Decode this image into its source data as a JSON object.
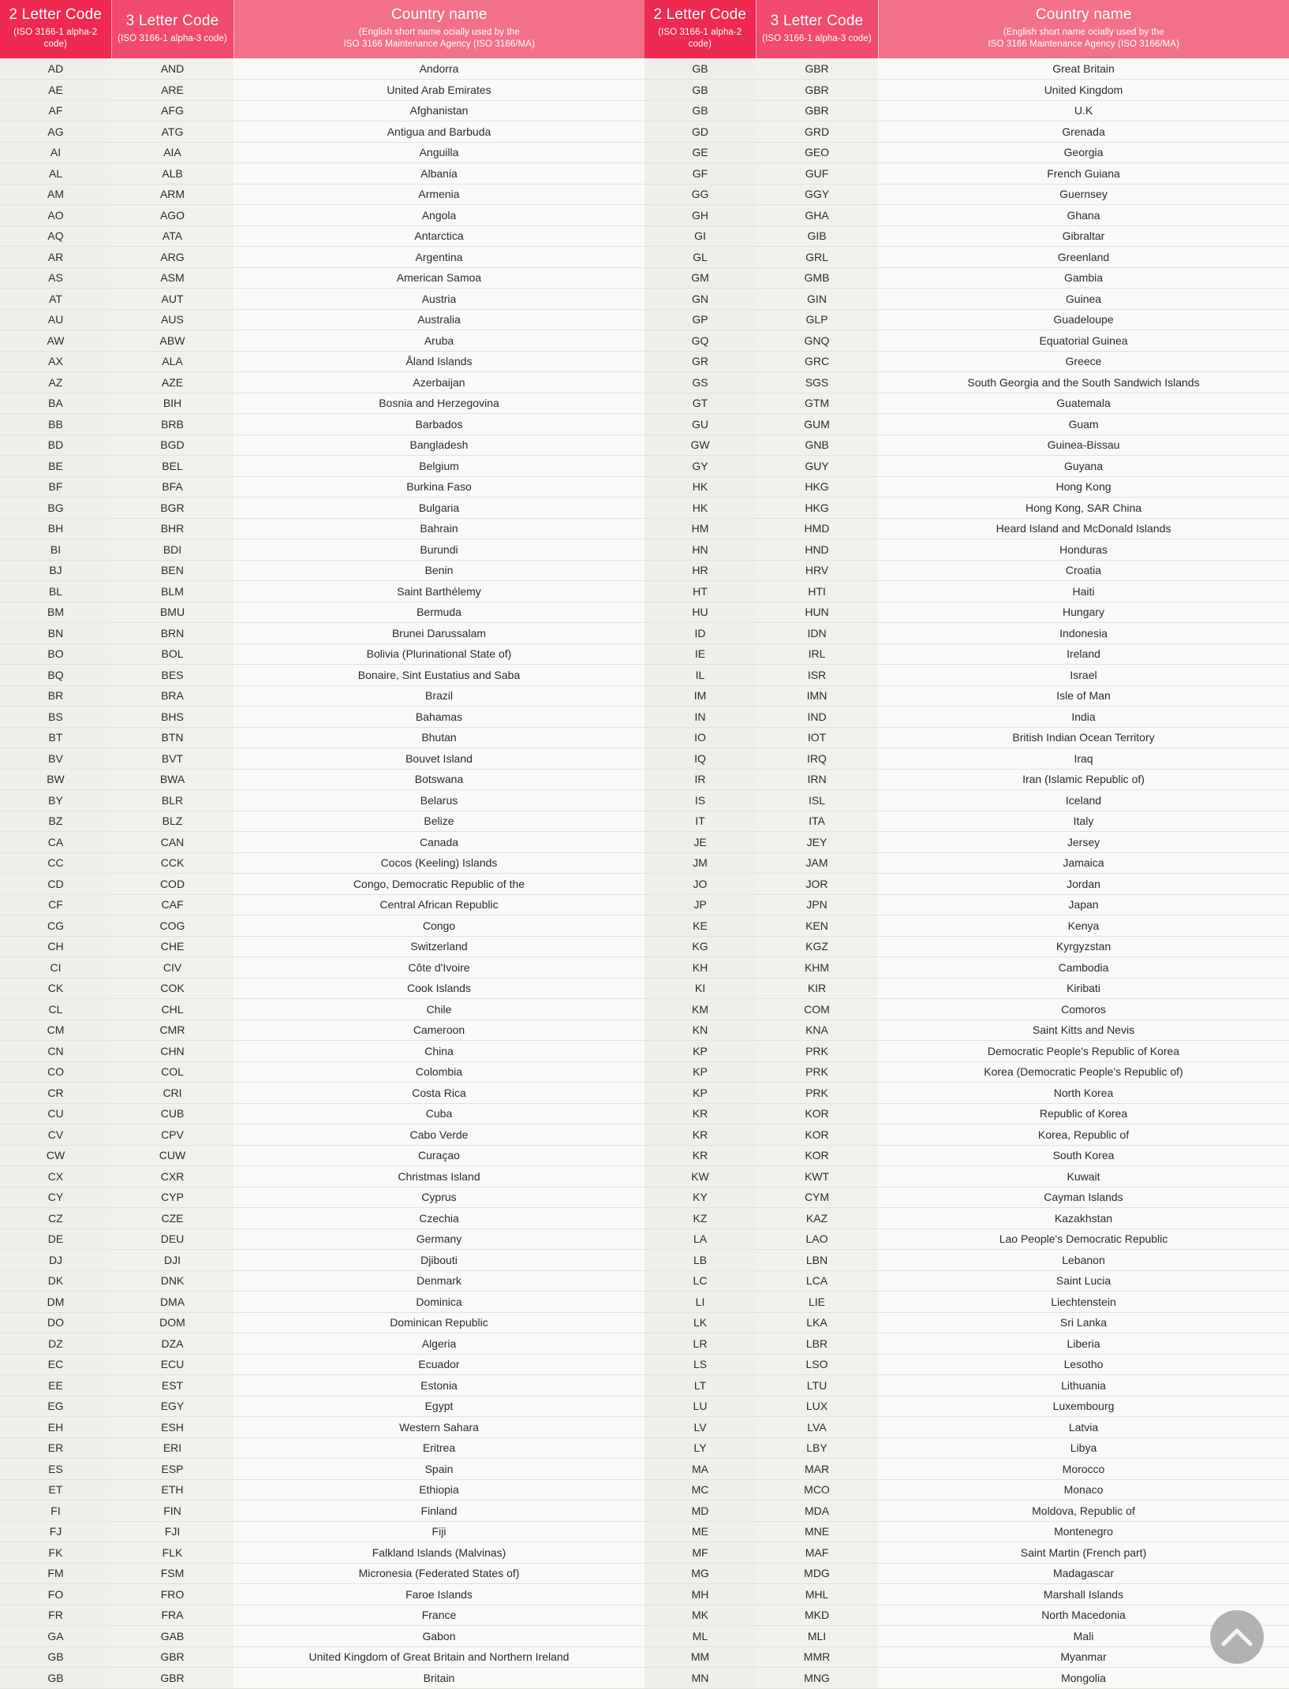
{
  "header": {
    "col_2letter_title": "2 Letter Code",
    "col_2letter_sub": "(ISO 3166-1 alpha-2 code)",
    "col_3letter_title": "3 Letter Code",
    "col_3letter_sub": "(ISO 3166-1 alpha-3 code)",
    "col_country_title": "Country name",
    "col_country_sub1": "(English short name ocially used by the",
    "col_country_sub2": "ISO 3166 Maintenance Agency (ISO 3166/MA)"
  },
  "colors": {
    "header_2letter": "#ef2a52",
    "header_3letter": "#f04a6d",
    "header_country": "#f27189",
    "row_2letter": "#efeeeb",
    "row_3letter": "#f1f0ed",
    "row_country": "#faf9f8",
    "row_border": "#e3e1de",
    "scroll_button": "#b4b2b0"
  },
  "controls": {
    "scroll_top_label": "scroll to top"
  },
  "left_table": [
    [
      "AD",
      "AND",
      "Andorra"
    ],
    [
      "AE",
      "ARE",
      "United Arab Emirates"
    ],
    [
      "AF",
      "AFG",
      "Afghanistan"
    ],
    [
      "AG",
      "ATG",
      "Antigua and Barbuda"
    ],
    [
      "AI",
      "AIA",
      "Anguilla"
    ],
    [
      "AL",
      "ALB",
      "Albania"
    ],
    [
      "AM",
      "ARM",
      "Armenia"
    ],
    [
      "AO",
      "AGO",
      "Angola"
    ],
    [
      "AQ",
      "ATA",
      "Antarctica"
    ],
    [
      "AR",
      "ARG",
      "Argentina"
    ],
    [
      "AS",
      "ASM",
      "American Samoa"
    ],
    [
      "AT",
      "AUT",
      "Austria"
    ],
    [
      "AU",
      "AUS",
      "Australia"
    ],
    [
      "AW",
      "ABW",
      "Aruba"
    ],
    [
      "AX",
      "ALA",
      "Åland Islands"
    ],
    [
      "AZ",
      "AZE",
      "Azerbaijan"
    ],
    [
      "BA",
      "BIH",
      "Bosnia and Herzegovina"
    ],
    [
      "BB",
      "BRB",
      "Barbados"
    ],
    [
      "BD",
      "BGD",
      "Bangladesh"
    ],
    [
      "BE",
      "BEL",
      "Belgium"
    ],
    [
      "BF",
      "BFA",
      "Burkina Faso"
    ],
    [
      "BG",
      "BGR",
      "Bulgaria"
    ],
    [
      "BH",
      "BHR",
      "Bahrain"
    ],
    [
      "BI",
      "BDI",
      "Burundi"
    ],
    [
      "BJ",
      "BEN",
      "Benin"
    ],
    [
      "BL",
      "BLM",
      "Saint Barthélemy"
    ],
    [
      "BM",
      "BMU",
      "Bermuda"
    ],
    [
      "BN",
      "BRN",
      "Brunei Darussalam"
    ],
    [
      "BO",
      "BOL",
      "Bolivia (Plurinational State of)"
    ],
    [
      "BQ",
      "BES",
      "Bonaire, Sint Eustatius and Saba"
    ],
    [
      "BR",
      "BRA",
      "Brazil"
    ],
    [
      "BS",
      "BHS",
      "Bahamas"
    ],
    [
      "BT",
      "BTN",
      "Bhutan"
    ],
    [
      "BV",
      "BVT",
      "Bouvet Island"
    ],
    [
      "BW",
      "BWA",
      "Botswana"
    ],
    [
      "BY",
      "BLR",
      "Belarus"
    ],
    [
      "BZ",
      "BLZ",
      "Belize"
    ],
    [
      "CA",
      "CAN",
      "Canada"
    ],
    [
      "CC",
      "CCK",
      "Cocos (Keeling) Islands"
    ],
    [
      "CD",
      "COD",
      "Congo, Democratic Republic of the"
    ],
    [
      "CF",
      "CAF",
      "Central African Republic"
    ],
    [
      "CG",
      "COG",
      "Congo"
    ],
    [
      "CH",
      "CHE",
      "Switzerland"
    ],
    [
      "CI",
      "CIV",
      "Côte d'Ivoire"
    ],
    [
      "CK",
      "COK",
      "Cook Islands"
    ],
    [
      "CL",
      "CHL",
      "Chile"
    ],
    [
      "CM",
      "CMR",
      "Cameroon"
    ],
    [
      "CN",
      "CHN",
      "China"
    ],
    [
      "CO",
      "COL",
      "Colombia"
    ],
    [
      "CR",
      "CRI",
      "Costa Rica"
    ],
    [
      "CU",
      "CUB",
      "Cuba"
    ],
    [
      "CV",
      "CPV",
      "Cabo Verde"
    ],
    [
      "CW",
      "CUW",
      "Curaçao"
    ],
    [
      "CX",
      "CXR",
      "Christmas Island"
    ],
    [
      "CY",
      "CYP",
      "Cyprus"
    ],
    [
      "CZ",
      "CZE",
      "Czechia"
    ],
    [
      "DE",
      "DEU",
      "Germany"
    ],
    [
      "DJ",
      "DJI",
      "Djibouti"
    ],
    [
      "DK",
      "DNK",
      "Denmark"
    ],
    [
      "DM",
      "DMA",
      "Dominica"
    ],
    [
      "DO",
      "DOM",
      "Dominican Republic"
    ],
    [
      "DZ",
      "DZA",
      "Algeria"
    ],
    [
      "EC",
      "ECU",
      "Ecuador"
    ],
    [
      "EE",
      "EST",
      "Estonia"
    ],
    [
      "EG",
      "EGY",
      "Egypt"
    ],
    [
      "EH",
      "ESH",
      "Western Sahara"
    ],
    [
      "ER",
      "ERI",
      "Eritrea"
    ],
    [
      "ES",
      "ESP",
      "Spain"
    ],
    [
      "ET",
      "ETH",
      "Ethiopia"
    ],
    [
      "FI",
      "FIN",
      "Finland"
    ],
    [
      "FJ",
      "FJI",
      "Fiji"
    ],
    [
      "FK",
      "FLK",
      "Falkland Islands (Malvinas)"
    ],
    [
      "FM",
      "FSM",
      "Micronesia (Federated States of)"
    ],
    [
      "FO",
      "FRO",
      "Faroe Islands"
    ],
    [
      "FR",
      "FRA",
      "France"
    ],
    [
      "GA",
      "GAB",
      "Gabon"
    ],
    [
      "GB",
      "GBR",
      "United Kingdom of Great Britain and Northern Ireland"
    ],
    [
      "GB",
      "GBR",
      "Britain"
    ]
  ],
  "right_table": [
    [
      "GB",
      "GBR",
      "Great Britain"
    ],
    [
      "GB",
      "GBR",
      "United Kingdom"
    ],
    [
      "GB",
      "GBR",
      "U.K"
    ],
    [
      "GD",
      "GRD",
      "Grenada"
    ],
    [
      "GE",
      "GEO",
      "Georgia"
    ],
    [
      "GF",
      "GUF",
      "French Guiana"
    ],
    [
      "GG",
      "GGY",
      "Guernsey"
    ],
    [
      "GH",
      "GHA",
      "Ghana"
    ],
    [
      "GI",
      "GIB",
      "Gibraltar"
    ],
    [
      "GL",
      "GRL",
      "Greenland"
    ],
    [
      "GM",
      "GMB",
      "Gambia"
    ],
    [
      "GN",
      "GIN",
      "Guinea"
    ],
    [
      "GP",
      "GLP",
      "Guadeloupe"
    ],
    [
      "GQ",
      "GNQ",
      "Equatorial Guinea"
    ],
    [
      "GR",
      "GRC",
      "Greece"
    ],
    [
      "GS",
      "SGS",
      "South Georgia and the South Sandwich Islands"
    ],
    [
      "GT",
      "GTM",
      "Guatemala"
    ],
    [
      "GU",
      "GUM",
      "Guam"
    ],
    [
      "GW",
      "GNB",
      "Guinea-Bissau"
    ],
    [
      "GY",
      "GUY",
      "Guyana"
    ],
    [
      "HK",
      "HKG",
      "Hong Kong"
    ],
    [
      "HK",
      "HKG",
      "Hong Kong, SAR China"
    ],
    [
      "HM",
      "HMD",
      "Heard Island and McDonald Islands"
    ],
    [
      "HN",
      "HND",
      "Honduras"
    ],
    [
      "HR",
      "HRV",
      "Croatia"
    ],
    [
      "HT",
      "HTI",
      "Haiti"
    ],
    [
      "HU",
      "HUN",
      "Hungary"
    ],
    [
      "ID",
      "IDN",
      "Indonesia"
    ],
    [
      "IE",
      "IRL",
      "Ireland"
    ],
    [
      "IL",
      "ISR",
      "Israel"
    ],
    [
      "IM",
      "IMN",
      "Isle of Man"
    ],
    [
      "IN",
      "IND",
      "India"
    ],
    [
      "IO",
      "IOT",
      "British Indian Ocean Territory"
    ],
    [
      "IQ",
      "IRQ",
      "Iraq"
    ],
    [
      "IR",
      "IRN",
      "Iran (Islamic Republic of)"
    ],
    [
      "IS",
      "ISL",
      "Iceland"
    ],
    [
      "IT",
      "ITA",
      "Italy"
    ],
    [
      "JE",
      "JEY",
      "Jersey"
    ],
    [
      "JM",
      "JAM",
      "Jamaica"
    ],
    [
      "JO",
      "JOR",
      "Jordan"
    ],
    [
      "JP",
      "JPN",
      "Japan"
    ],
    [
      "KE",
      "KEN",
      "Kenya"
    ],
    [
      "KG",
      "KGZ",
      "Kyrgyzstan"
    ],
    [
      "KH",
      "KHM",
      "Cambodia"
    ],
    [
      "KI",
      "KIR",
      "Kiribati"
    ],
    [
      "KM",
      "COM",
      "Comoros"
    ],
    [
      "KN",
      "KNA",
      "Saint Kitts and Nevis"
    ],
    [
      "KP",
      "PRK",
      "Democratic People's Republic of Korea"
    ],
    [
      "KP",
      "PRK",
      "Korea (Democratic People's Republic of)"
    ],
    [
      "KP",
      "PRK",
      "North Korea"
    ],
    [
      "KR",
      "KOR",
      "Republic of Korea"
    ],
    [
      "KR",
      "KOR",
      "Korea, Republic of"
    ],
    [
      "KR",
      "KOR",
      "South Korea"
    ],
    [
      "KW",
      "KWT",
      "Kuwait"
    ],
    [
      "KY",
      "CYM",
      "Cayman Islands"
    ],
    [
      "KZ",
      "KAZ",
      "Kazakhstan"
    ],
    [
      "LA",
      "LAO",
      "Lao People's Democratic Republic"
    ],
    [
      "LB",
      "LBN",
      "Lebanon"
    ],
    [
      "LC",
      "LCA",
      "Saint Lucia"
    ],
    [
      "LI",
      "LIE",
      "Liechtenstein"
    ],
    [
      "LK",
      "LKA",
      "Sri Lanka"
    ],
    [
      "LR",
      "LBR",
      "Liberia"
    ],
    [
      "LS",
      "LSO",
      "Lesotho"
    ],
    [
      "LT",
      "LTU",
      "Lithuania"
    ],
    [
      "LU",
      "LUX",
      "Luxembourg"
    ],
    [
      "LV",
      "LVA",
      "Latvia"
    ],
    [
      "LY",
      "LBY",
      "Libya"
    ],
    [
      "MA",
      "MAR",
      "Morocco"
    ],
    [
      "MC",
      "MCO",
      "Monaco"
    ],
    [
      "MD",
      "MDA",
      "Moldova, Republic of"
    ],
    [
      "ME",
      "MNE",
      "Montenegro"
    ],
    [
      "MF",
      "MAF",
      "Saint Martin (French part)"
    ],
    [
      "MG",
      "MDG",
      "Madagascar"
    ],
    [
      "MH",
      "MHL",
      "Marshall Islands"
    ],
    [
      "MK",
      "MKD",
      "North Macedonia"
    ],
    [
      "ML",
      "MLI",
      "Mali"
    ],
    [
      "MM",
      "MMR",
      "Myanmar"
    ],
    [
      "MN",
      "MNG",
      "Mongolia"
    ]
  ]
}
